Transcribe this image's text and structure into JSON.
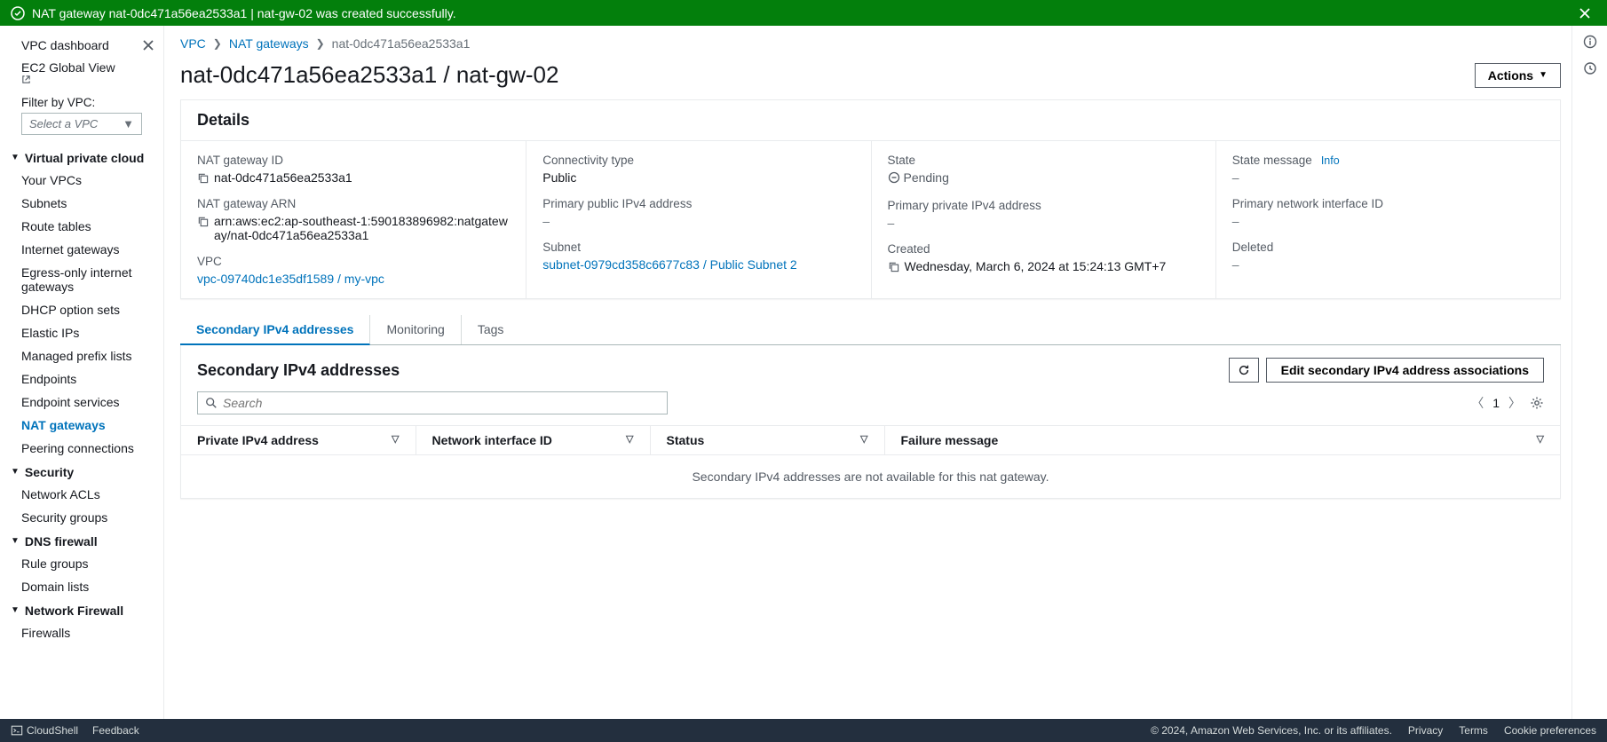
{
  "flash": {
    "message": "NAT gateway nat-0dc471a56ea2533a1 | nat-gw-02 was created successfully."
  },
  "sidebar": {
    "dashboard": "VPC dashboard",
    "global_view": "EC2 Global View",
    "filter_label": "Filter by VPC:",
    "filter_placeholder": "Select a VPC",
    "sections": {
      "vpc": {
        "title": "Virtual private cloud",
        "items": [
          "Your VPCs",
          "Subnets",
          "Route tables",
          "Internet gateways",
          "Egress-only internet gateways",
          "DHCP option sets",
          "Elastic IPs",
          "Managed prefix lists",
          "Endpoints",
          "Endpoint services",
          "NAT gateways",
          "Peering connections"
        ]
      },
      "security": {
        "title": "Security",
        "items": [
          "Network ACLs",
          "Security groups"
        ]
      },
      "dns": {
        "title": "DNS firewall",
        "items": [
          "Rule groups",
          "Domain lists"
        ]
      },
      "netfw": {
        "title": "Network Firewall",
        "items": [
          "Firewalls"
        ]
      }
    }
  },
  "breadcrumb": {
    "l0": "VPC",
    "l1": "NAT gateways",
    "l2": "nat-0dc471a56ea2533a1"
  },
  "page_title": "nat-0dc471a56ea2533a1 / nat-gw-02",
  "actions_label": "Actions",
  "details": {
    "heading": "Details",
    "nat_id_label": "NAT gateway ID",
    "nat_id": "nat-0dc471a56ea2533a1",
    "nat_arn_label": "NAT gateway ARN",
    "nat_arn": "arn:aws:ec2:ap-southeast-1:590183896982:natgateway/nat-0dc471a56ea2533a1",
    "vpc_label": "VPC",
    "vpc_link": "vpc-09740dc1e35df1589 / my-vpc",
    "conn_label": "Connectivity type",
    "conn_val": "Public",
    "pub_ip_label": "Primary public IPv4 address",
    "subnet_label": "Subnet",
    "subnet_link": "subnet-0979cd358c6677c83 / Public Subnet 2",
    "state_label": "State",
    "state_val": "Pending",
    "priv_ip_label": "Primary private IPv4 address",
    "created_label": "Created",
    "created_val": "Wednesday, March 6, 2024 at 15:24:13 GMT+7",
    "state_msg_label": "State message",
    "info": "Info",
    "pni_label": "Primary network interface ID",
    "deleted_label": "Deleted",
    "dash": "–"
  },
  "tabs": {
    "t0": "Secondary IPv4 addresses",
    "t1": "Monitoring",
    "t2": "Tags"
  },
  "secondary": {
    "heading": "Secondary IPv4 addresses",
    "edit_btn": "Edit secondary IPv4 address associations",
    "search_placeholder": "Search",
    "page": "1",
    "cols": {
      "c0": "Private IPv4 address",
      "c1": "Network interface ID",
      "c2": "Status",
      "c3": "Failure message"
    },
    "empty": "Secondary IPv4 addresses are not available for this nat gateway."
  },
  "footer": {
    "cloudshell": "CloudShell",
    "feedback": "Feedback",
    "copyright": "© 2024, Amazon Web Services, Inc. or its affiliates.",
    "privacy": "Privacy",
    "terms": "Terms",
    "cookie": "Cookie preferences"
  }
}
